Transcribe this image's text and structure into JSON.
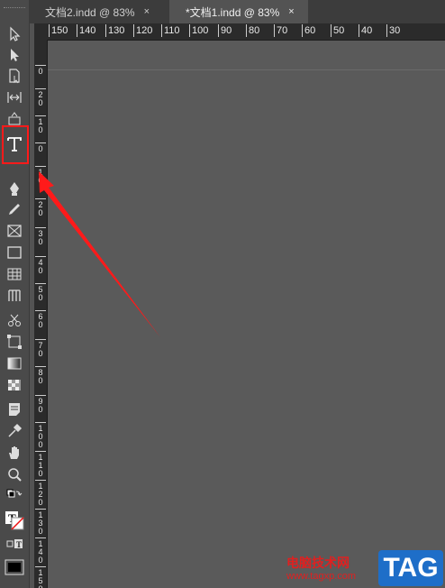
{
  "tabs": [
    {
      "label": "文档2.indd @ 83%",
      "close": "×"
    },
    {
      "label": "*文档1.indd @ 83%",
      "close": "×"
    }
  ],
  "hruler": [
    "150",
    "140",
    "130",
    "120",
    "110",
    "100",
    "90",
    "80",
    "70",
    "60",
    "50",
    "40",
    "30"
  ],
  "vruler": [
    "0",
    "2 0",
    "1 0",
    "0",
    "1 0",
    "2 0",
    "3 0",
    "4 0",
    "5 0",
    "6 0",
    "7 0",
    "8 0",
    "9 0",
    "1 0 0",
    "1 1 0",
    "1 2 0",
    "1 3 0",
    "1 4 0",
    "1 5 0"
  ],
  "tools": [
    "selection-tool-icon",
    "direct-selection-tool-icon",
    "page-tool-icon",
    "gap-tool-icon",
    "content-collector-icon",
    "type-tool-icon",
    "line-tool-icon",
    "pen-tool-icon",
    "pencil-tool-icon",
    "rectangle-frame-tool-icon",
    "rectangle-tool-icon",
    "table-icon",
    "grid-icon",
    "scissors-tool-icon",
    "free-transform-tool-icon",
    "gradient-swatch-tool-icon",
    "gradient-feather-tool-icon",
    "note-tool-icon",
    "eyedropper-tool-icon",
    "hand-tool-icon",
    "zoom-tool-icon",
    "swap-colors-icon",
    "fill-stroke-icon",
    "formatting-affects-text-icon",
    "screen-mode-icon"
  ],
  "watermark": {
    "title": "电脑技术网",
    "url": "www.tagxp.com",
    "logo": "TAG"
  },
  "colors": {
    "highlight": "#ff1a1a",
    "arrow": "#ff1a1a"
  }
}
